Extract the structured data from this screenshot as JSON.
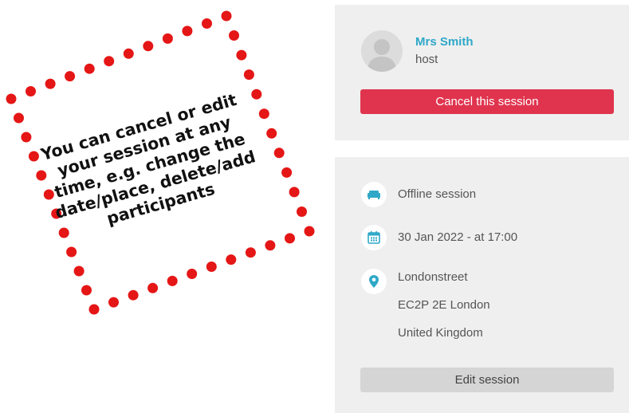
{
  "annotation": {
    "lines": [
      "You can cancel or edit",
      "your session at any",
      "time, e.g. change the",
      "date/place, delete/add",
      "participants"
    ],
    "dot_color": "#e51616"
  },
  "host_card": {
    "name": "Mrs Smith",
    "role": "host",
    "cancel_label": "Cancel this session"
  },
  "details_card": {
    "session_type": "Offline session",
    "date_time": "30 Jan 2022 - at 17:00",
    "address": {
      "street": "Londonstreet",
      "city": "EC2P 2E London",
      "country": "United Kingdom"
    },
    "edit_label": "Edit session"
  },
  "icons": {
    "session_type": "sofa-icon",
    "date": "calendar-icon",
    "location": "map-pin-icon",
    "avatar": "user-silhouette-icon"
  },
  "colors": {
    "accent": "#2fa8c8",
    "danger": "#e0344e",
    "card_bg": "#efefef",
    "secondary_button": "#d5d5d5"
  }
}
